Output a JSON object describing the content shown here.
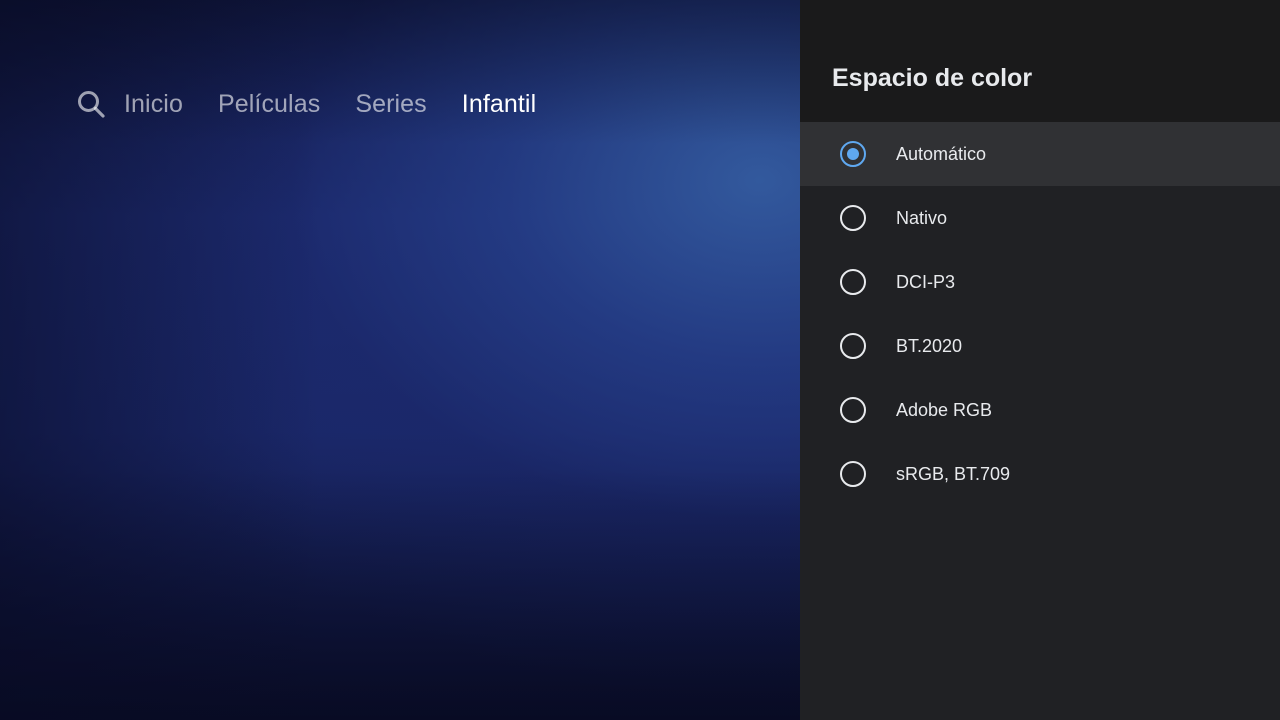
{
  "nav": {
    "search_icon": "search-icon",
    "items": [
      {
        "label": "Inicio",
        "active": false
      },
      {
        "label": "Películas",
        "active": false
      },
      {
        "label": "Series",
        "active": false
      },
      {
        "label": "Infantil",
        "active": true
      }
    ]
  },
  "panel": {
    "title": "Espacio de color",
    "options": [
      {
        "label": "Automático",
        "selected": true,
        "focused": true
      },
      {
        "label": "Nativo",
        "selected": false,
        "focused": false
      },
      {
        "label": "DCI-P3",
        "selected": false,
        "focused": false
      },
      {
        "label": "BT.2020",
        "selected": false,
        "focused": false
      },
      {
        "label": "Adobe RGB",
        "selected": false,
        "focused": false
      },
      {
        "label": "sRGB, BT.709",
        "selected": false,
        "focused": false
      }
    ]
  },
  "colors": {
    "accent": "#5fa8f0",
    "panel_bg": "#202124",
    "panel_header_bg": "#1a1a1b",
    "focused_row_bg": "#303134",
    "text_primary": "#e8eaed"
  }
}
